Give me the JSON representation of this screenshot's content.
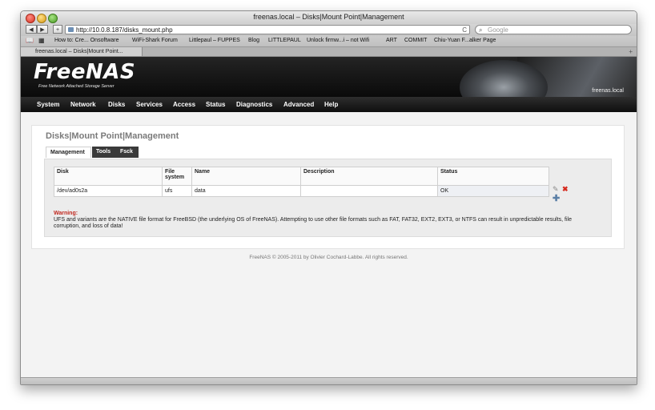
{
  "window": {
    "title": "freenas.local – Disks|Mount Point|Management"
  },
  "toolbar": {
    "back": "◀",
    "forward": "▶",
    "add": "+",
    "url": "http://10.0.8.187/disks_mount.php",
    "reload": "C",
    "search_placeholder": "Google"
  },
  "bookmarks": [
    "How to: Cre... Onsoftware",
    "WiFi-Shark Forum",
    "Littlepaul – FUPPES",
    "Blog",
    "LITTLEPAUL",
    "Unlock firmw...i – not Wifi",
    "ART",
    "COMMIT",
    "Chiu-Yuan F...alker Page"
  ],
  "tab": {
    "label": "freenas.local – Disks|Mount Point...",
    "new_tab": "+"
  },
  "banner": {
    "logo": "FreeNAS",
    "tagline": "Free Network Attached Storage Server",
    "hostname": "freenas.local"
  },
  "menu": [
    "System",
    "Network",
    "Disks",
    "Services",
    "Access",
    "Status",
    "Diagnostics",
    "Advanced",
    "Help"
  ],
  "page": {
    "title": "Disks|Mount Point|Management",
    "tabs": [
      "Management",
      "Tools",
      "Fsck"
    ]
  },
  "table": {
    "headers": [
      "Disk",
      "File system",
      "Name",
      "Description",
      "Status"
    ],
    "rows": [
      {
        "disk": "/dev/ad0s2a",
        "fs": "ufs",
        "name": "data",
        "description": "",
        "status": "OK"
      }
    ]
  },
  "icons": {
    "edit": "edit-icon",
    "delete": "delete-icon",
    "add": "add-icon"
  },
  "warning": {
    "label": "Warning:",
    "text": "UFS and variants are the NATIVE file format for FreeBSD (the underlying OS of FreeNAS). Attempting to use other file formats such as FAT, FAT32, EXT2, EXT3, or NTFS can result in unpredictable results, file corruption, and loss of data!"
  },
  "footer": "FreeNAS © 2005-2011 by Olivier Cochard-Labbe. All rights reserved."
}
